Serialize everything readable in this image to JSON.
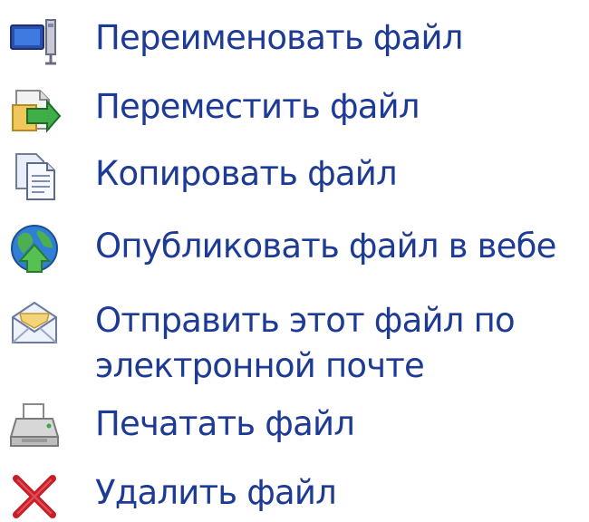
{
  "file_tasks": {
    "items": [
      {
        "icon": "rename-icon",
        "label": "Переименовать файл"
      },
      {
        "icon": "move-icon",
        "label": "Переместить файл"
      },
      {
        "icon": "copy-icon",
        "label": "Копировать файл"
      },
      {
        "icon": "publish-web-icon",
        "label": "Опубликовать файл в вебе"
      },
      {
        "icon": "email-icon",
        "label_line1": "Отправить этот файл по",
        "label_line2": "электронной почте"
      },
      {
        "icon": "print-icon",
        "label": "Печатать файл"
      },
      {
        "icon": "delete-icon",
        "label": "Удалить файл"
      }
    ]
  }
}
